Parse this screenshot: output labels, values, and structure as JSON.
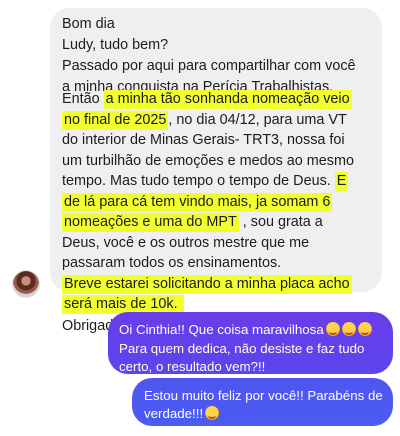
{
  "incoming_message": {
    "lines": [
      "Bom dia",
      "Ludy, tudo bem?",
      "Passado por aqui para compartilhar com você",
      "a minha conquista na Perícia Trabalhistas.",
      "Então ",
      "a minha tão sonhanda nomeação veio",
      "no final de 2025",
      ", no dia 04/12, para uma VT",
      "do interior de Minas Gerais- TRT3,  nossa foi",
      "um turbilhão de emoções e medos ao mesmo",
      "tempo.  Mas tudo tempo o tempo de Deus. ",
      "E",
      "de lá para cá tem vindo mais, ja somam 6",
      "nomeações e  uma do MPT",
      " , sou grata a",
      "Deus, você e os outros mestre que me",
      "passaram todos os ensinamentos.",
      "Breve estarei solicitando a minha placa acho",
      "será mais de 10k.",
      "Obrigada,  abraços."
    ]
  },
  "outgoing_messages": [
    {
      "lines": [
        "Oi Cinthia!!  Que coisa maravilhosa",
        "Para quem dedica, não desiste e faz tudo",
        "certo, o resultado vem?!!"
      ],
      "emoji": [
        "smiling-face-with-hearts",
        "smiling-face-with-hearts",
        "smiling-face-with-hearts"
      ]
    },
    {
      "lines": [
        "Estou muito feliz por você!! Parabéns de",
        "verdade!!!"
      ],
      "emoji": [
        "smiling-face-with-heart-eyes"
      ]
    }
  ],
  "colors": {
    "incoming_bubble": "#efeff1",
    "highlight": "#f2ff2e",
    "outgoing_bubble_1": "#6a3de8",
    "outgoing_bubble_2": "#4f55f0"
  }
}
